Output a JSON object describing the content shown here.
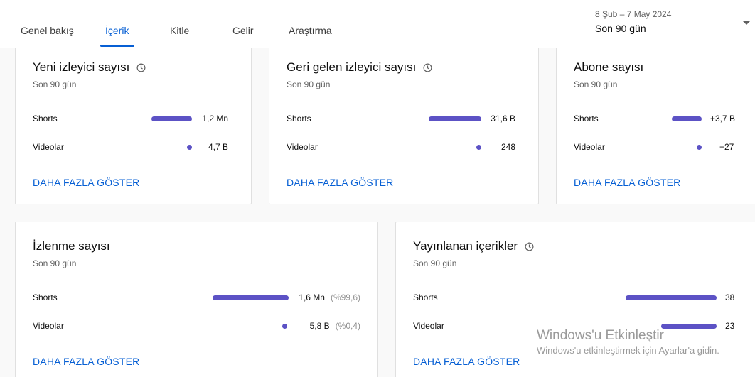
{
  "tabs": [
    {
      "label": "Genel bakış"
    },
    {
      "label": "İçerik",
      "active": true
    },
    {
      "label": "Kitle"
    },
    {
      "label": "Gelir"
    },
    {
      "label": "Araştırma"
    }
  ],
  "date_range": "8 Şub – 7 May 2024",
  "period_label": "Son 90 gün",
  "accent_color": "#065fd4",
  "bar_color": "#5c52c5",
  "cards": [
    {
      "title": "Yeni izleyici sayısı",
      "has_info_icon": true,
      "subtitle": "Son 90 gün",
      "rows": [
        {
          "label": "Shorts",
          "value": "1,2 Mn",
          "share": 1.0
        },
        {
          "label": "Videolar",
          "value": "4,7 B",
          "share": 0.004
        }
      ],
      "show_more": "DAHA FAZLA GÖSTER"
    },
    {
      "title": "Geri gelen izleyici sayısı",
      "has_info_icon": true,
      "subtitle": "Son 90 gün",
      "rows": [
        {
          "label": "Shorts",
          "value": "31,6 B",
          "share": 1.0
        },
        {
          "label": "Videolar",
          "value": "248",
          "share": 0.008
        }
      ],
      "show_more": "DAHA FAZLA GÖSTER"
    },
    {
      "title": "Abone sayısı",
      "has_info_icon": false,
      "subtitle": "Son 90 gün",
      "rows": [
        {
          "label": "Shorts",
          "value": "+3,7 B",
          "share": 1.0
        },
        {
          "label": "Videolar",
          "value": "+27",
          "share": 0.007
        }
      ],
      "show_more": "DAHA FAZLA GÖSTER"
    },
    {
      "title": "İzlenme sayısı",
      "has_info_icon": false,
      "subtitle": "Son 90 gün",
      "rows": [
        {
          "label": "Shorts",
          "value": "1,6 Mn",
          "pct": "(%99,6)",
          "share": 0.996
        },
        {
          "label": "Videolar",
          "value": "5,8 B",
          "pct": "(%0,4)",
          "share": 0.004
        }
      ],
      "show_more": "DAHA FAZLA GÖSTER"
    },
    {
      "title": "Yayınlanan içerikler",
      "has_info_icon": true,
      "subtitle": "Son 90 gün",
      "rows": [
        {
          "label": "Shorts",
          "value": "38",
          "share": 1.0
        },
        {
          "label": "Videolar",
          "value": "23",
          "share": 0.605
        }
      ],
      "show_more": "DAHA FAZLA GÖSTER"
    }
  ],
  "watermark": {
    "title": "Windows'u Etkinleştir",
    "subtitle": "Windows'u etkinleştirmek için Ayarlar'a gidin."
  }
}
